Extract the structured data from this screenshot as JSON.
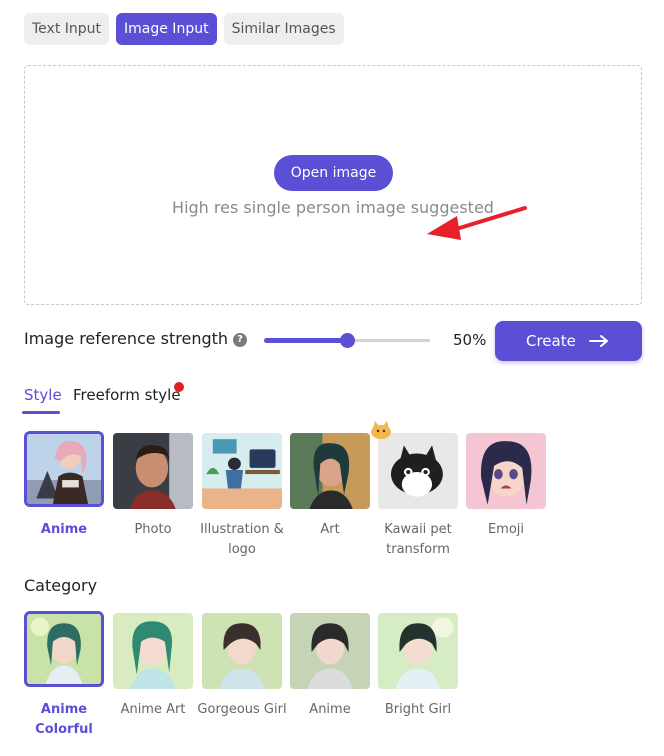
{
  "input_tabs": [
    {
      "label": "Text Input",
      "active": false
    },
    {
      "label": "Image Input",
      "active": true
    },
    {
      "label": "Similar Images",
      "active": false
    }
  ],
  "upload": {
    "open_button_label": "Open image",
    "hint": "High res single person image suggested"
  },
  "strength": {
    "label": "Image reference strength",
    "help_icon": "question-mark-icon",
    "value_percent": 50,
    "value_text": "50%"
  },
  "create_button": {
    "label": "Create",
    "icon": "arrow-right-icon"
  },
  "style_tabs": [
    {
      "label": "Style",
      "active": true
    },
    {
      "label": "Freeform style",
      "active": false,
      "badge": "new-dot"
    }
  ],
  "styles": [
    {
      "label": "Anime",
      "selected": true
    },
    {
      "label": "Photo",
      "selected": false
    },
    {
      "label": "Illustration & logo",
      "selected": false
    },
    {
      "label": "Art",
      "selected": false
    },
    {
      "label": "Kawaii pet transform",
      "selected": false
    },
    {
      "label": "Emoji",
      "selected": false
    }
  ],
  "category": {
    "heading": "Category",
    "items": [
      {
        "label": "Anime Colorful",
        "selected": true
      },
      {
        "label": "Anime Art",
        "selected": false
      },
      {
        "label": "Gorgeous Girl",
        "selected": false
      },
      {
        "label": "Anime",
        "selected": false
      },
      {
        "label": "Bright Girl",
        "selected": false
      }
    ]
  },
  "colors": {
    "accent": "#5b4fd6",
    "annotation_arrow": "#e8202a",
    "badge": "#e01f1f"
  }
}
